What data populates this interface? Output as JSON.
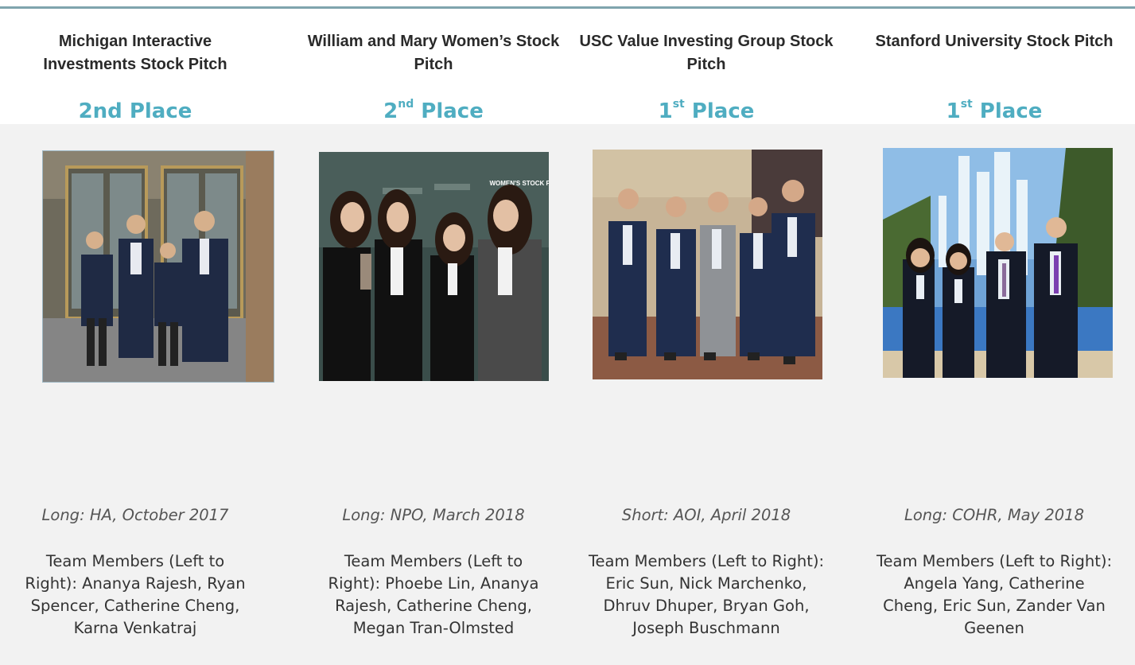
{
  "columns": [
    {
      "title": "Michigan Interactive Investments Stock Pitch",
      "place_main": "2nd Place",
      "place_sup": "",
      "place_rest": "",
      "pitch": "Long: HA, October 2017",
      "members": "Team Members (Left to Right): Ananya Rajesh, Ryan Spencer, Catherine Cheng, Karna Venkatraj"
    },
    {
      "title": "William and Mary Women’s Stock Pitch",
      "place_main": "2",
      "place_sup": "nd",
      "place_rest": " Place",
      "pitch": "Long: NPO, March 2018",
      "members": "Team Members (Left to Right): Phoebe Lin, Ananya Rajesh, Catherine Cheng, Megan Tran-Olmsted"
    },
    {
      "title": "USC Value Investing Group Stock Pitch",
      "place_main": "1",
      "place_sup": "st",
      "place_rest": " Place",
      "pitch": "Short: AOI, April 2018",
      "members": "Team Members (Left to Right): Eric Sun, Nick Marchenko, Dhruv Dhuper, Bryan Goh, Joseph Buschmann"
    },
    {
      "title": "Stanford University Stock Pitch",
      "place_main": "1",
      "place_sup": "st",
      "place_rest": " Place",
      "pitch": "Long: COHR, May 2018",
      "members": "Team Members (Left to Right): Angela Yang, Catherine Cheng, Eric Sun, Zander Van Geenen"
    }
  ],
  "photo_backdrop_text": {
    "banner_logo": "WOMEN'S STOCK PITCH"
  },
  "colors": {
    "accent": "#4fadc1",
    "rule": "#7fa4ad",
    "panel": "#f2f2f2"
  }
}
